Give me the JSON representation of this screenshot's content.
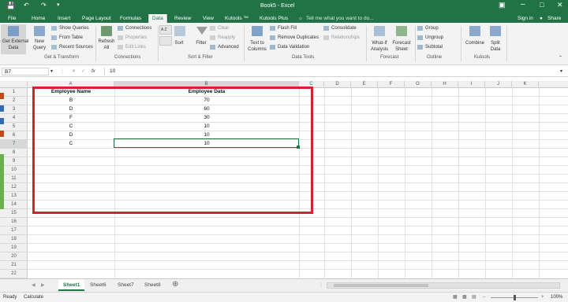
{
  "title": "Book5 - Excel",
  "menu_tabs": [
    "File",
    "Home",
    "Insert",
    "Page Layout",
    "Formulas",
    "Data",
    "Review",
    "View",
    "Kutools ™",
    "Kutools Plus"
  ],
  "tell_me": "Tell me what you want to do...",
  "sign_in": "Sign in",
  "share": "Share",
  "ribbon": {
    "get_external": [
      "Get External",
      "Data"
    ],
    "new_query": [
      "New",
      "Query"
    ],
    "show_queries": "Show Queries",
    "from_table": "From Table",
    "recent_sources": "Recent Sources",
    "refresh": [
      "Refresh",
      "All"
    ],
    "connections": "Connections",
    "properties": "Properties",
    "edit_links": "Edit Links",
    "sort_az": "A Z",
    "sort": "Sort",
    "filter": "Filter",
    "clear": "Clear",
    "reapply": "Reapply",
    "advanced": "Advanced",
    "text_to_columns": [
      "Text to",
      "Columns"
    ],
    "flash_fill": "Flash Fill",
    "remove_duplicates": "Remove Duplicates",
    "data_validation": "Data Validation",
    "consolidate": "Consolidate",
    "relationships": "Relationships",
    "what_if": [
      "What-If",
      "Analysis"
    ],
    "forecast_sheet": [
      "Forecast",
      "Sheet"
    ],
    "group": "Group",
    "ungroup": "Ungroup",
    "subtotal": "Subtotal",
    "combine": "Combine",
    "split_data": [
      "Split",
      "Data"
    ],
    "groups": [
      "Get & Transform",
      "Connections",
      "Sort & Filter",
      "Data Tools",
      "Forecast",
      "Outline",
      "Kutools"
    ]
  },
  "formula_bar": {
    "name_box": "B7",
    "fx": "fx",
    "value": "10"
  },
  "columns": [
    "A",
    "B",
    "C",
    "D",
    "E",
    "F",
    "G",
    "H",
    "I",
    "J",
    "K"
  ],
  "rows": [
    "1",
    "2",
    "3",
    "4",
    "5",
    "6",
    "7",
    "8",
    "9",
    "10",
    "11",
    "12",
    "13",
    "14",
    "15",
    "16",
    "17",
    "18",
    "19",
    "20",
    "21",
    "22"
  ],
  "table": {
    "headers": [
      "Employee Name",
      "Employee Data"
    ],
    "rows": [
      [
        "B",
        "70"
      ],
      [
        "D",
        "60"
      ],
      [
        "F",
        "30"
      ],
      [
        "C",
        "10"
      ],
      [
        "D",
        "10"
      ],
      [
        "C",
        "10"
      ]
    ]
  },
  "sheets": [
    "Sheet1",
    "Sheet6",
    "Sheet7",
    "Sheet8"
  ],
  "status": {
    "left": "Ready",
    "calc": "Calculate",
    "zoom": "100%"
  },
  "colors": {
    "excel_green": "#217346",
    "highlight_red": "#d3232e",
    "active_cell": "#217346"
  }
}
